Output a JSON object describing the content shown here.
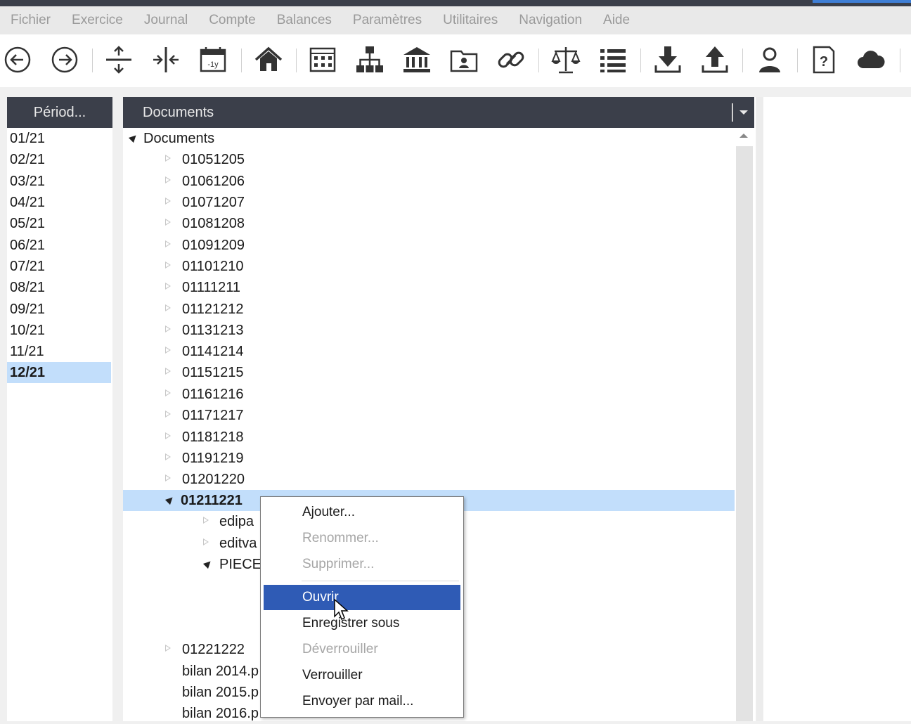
{
  "menubar": {
    "items": [
      "Fichier",
      "Exercice",
      "Journal",
      "Compte",
      "Balances",
      "Paramètres",
      "Utilitaires",
      "Navigation",
      "Aide"
    ]
  },
  "toolbar": {
    "icons": [
      "back-icon",
      "forward-icon",
      "expand-vertical-icon",
      "expand-horizontal-icon",
      "calendar-icon",
      "home-icon",
      "building-icon",
      "org-chart-icon",
      "bank-icon",
      "id-card-icon",
      "link-icon",
      "balance-scale-icon",
      "list-icon",
      "download-icon",
      "upload-icon",
      "user-icon",
      "help-icon",
      "cloud-icon"
    ]
  },
  "period_panel": {
    "header": "Périod...",
    "items": [
      "01/21",
      "02/21",
      "03/21",
      "04/21",
      "05/21",
      "06/21",
      "07/21",
      "08/21",
      "09/21",
      "10/21",
      "11/21",
      "12/21"
    ],
    "selected": "12/21"
  },
  "documents_panel": {
    "header": "Documents",
    "root": "Documents",
    "folders": [
      "01051205",
      "01061206",
      "01071207",
      "01081208",
      "01091209",
      "01101210",
      "01111211",
      "01121212",
      "01131213",
      "01141214",
      "01151215",
      "01161216",
      "01171217",
      "01181218",
      "01191219",
      "01201220"
    ],
    "expanded_folder": "01211221",
    "children": [
      "edipa",
      "editva",
      "PIECE"
    ],
    "after": [
      "01221222",
      "bilan 2014.p",
      "bilan 2015.p",
      "bilan 2016.p"
    ]
  },
  "context_menu": {
    "items": [
      {
        "label": "Ajouter...",
        "state": "enabled"
      },
      {
        "label": "Renommer...",
        "state": "disabled"
      },
      {
        "label": "Supprimer...",
        "state": "disabled"
      },
      {
        "label": "Ouvrir",
        "state": "highlighted"
      },
      {
        "label": "Enregistrer sous",
        "state": "enabled"
      },
      {
        "label": "Déverrouiller",
        "state": "disabled"
      },
      {
        "label": "Verrouiller",
        "state": "enabled"
      },
      {
        "label": "Envoyer par mail...",
        "state": "enabled"
      }
    ]
  },
  "colors": {
    "header_bg": "#3b3f4a",
    "selection": "#c2defb",
    "menu_highlight": "#2f5bb5"
  }
}
